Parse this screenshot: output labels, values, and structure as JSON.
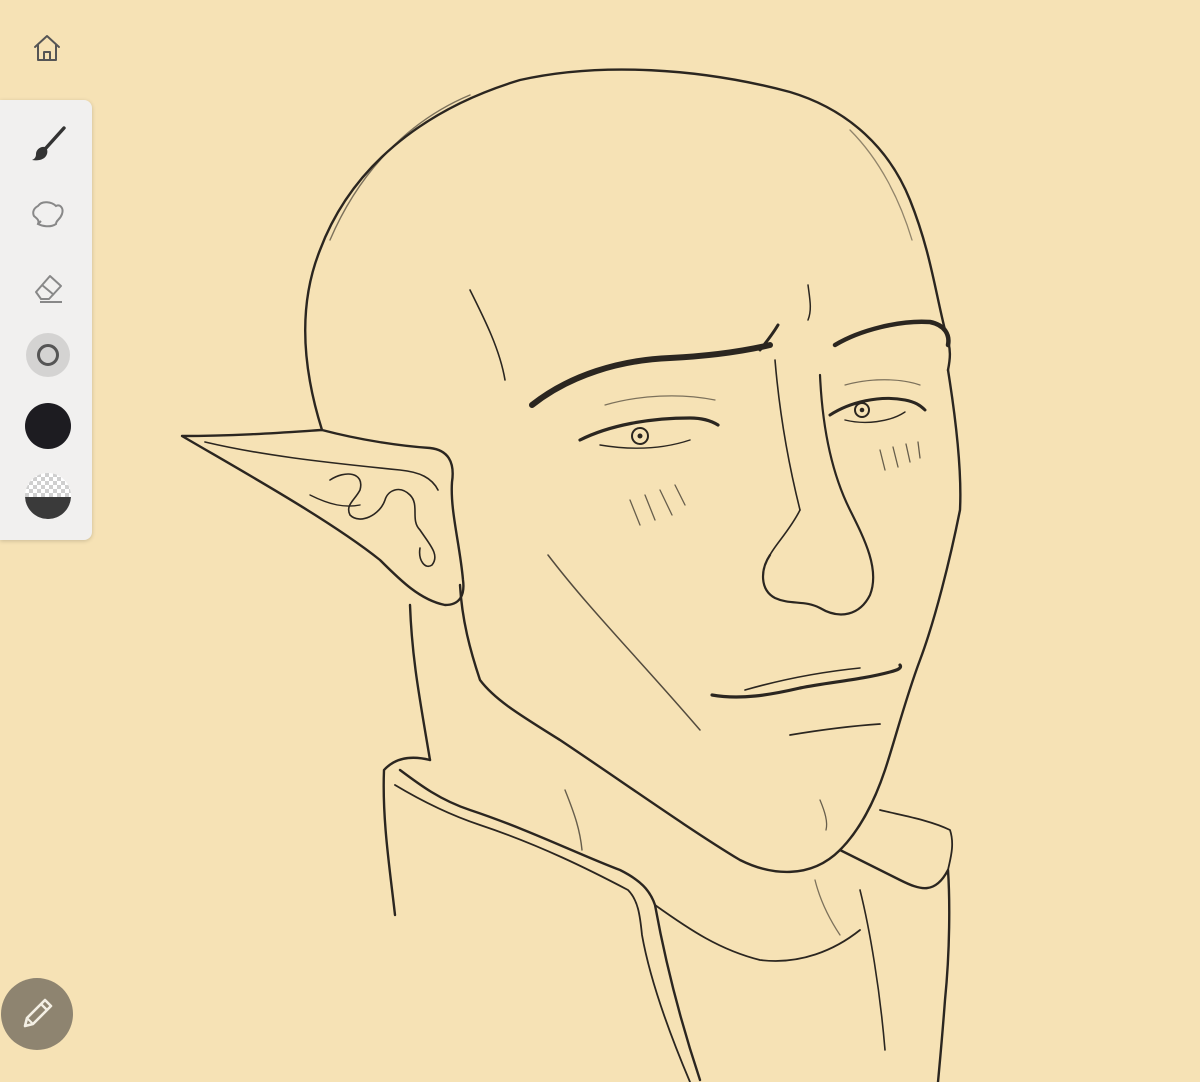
{
  "app": {
    "background_color": "#f6e2b5",
    "stroke_color": "#2b2620"
  },
  "nav": {
    "home_icon": "home-icon"
  },
  "toolbar": {
    "tools": [
      {
        "name": "brush",
        "icon": "brush-icon",
        "selected": true
      },
      {
        "name": "lasso",
        "icon": "lasso-icon",
        "selected": false
      },
      {
        "name": "eraser",
        "icon": "eraser-icon",
        "selected": false
      }
    ],
    "brush_size_icon": "brush-size-icon",
    "current_color": "#1d1c21",
    "opacity_icon": "opacity-icon"
  },
  "fab": {
    "icon": "pencil-icon",
    "background": "#8e8470"
  }
}
